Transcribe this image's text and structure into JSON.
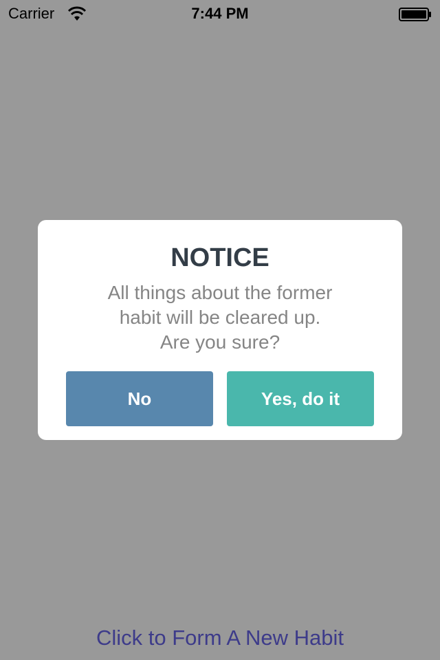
{
  "status_bar": {
    "carrier": "Carrier",
    "time": "7:44 PM",
    "wifi_icon": "wifi-icon",
    "battery_icon": "battery-icon"
  },
  "dialog": {
    "title": "NOTICE",
    "message_lines": [
      "All things about the former",
      "habit will be cleared up.",
      "Are you sure?"
    ],
    "no_label": "No",
    "yes_label": "Yes, do it"
  },
  "bottom_link": {
    "label": "Click to Form A New Habit"
  },
  "colors": {
    "backdrop": "#999999",
    "dialog_bg": "#ffffff",
    "title": "#333d47",
    "message": "#858585",
    "no_button": "#5887ad",
    "yes_button": "#4ab7ac",
    "link": "#3d3b8a"
  }
}
